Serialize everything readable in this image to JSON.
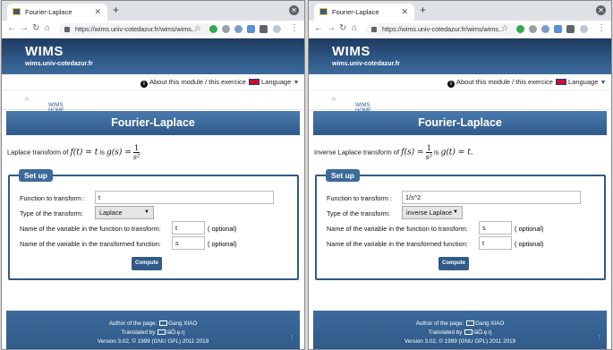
{
  "panes": [
    {
      "tab_title": "Fourier-Laplace",
      "url": "https://wims.univ-cotedazur.fr/wims/wims...",
      "site_title": "WIMS",
      "site_sub": "wims.univ-cotedazur.fr",
      "about_label": "About this module / this exercice",
      "language_label": "Language",
      "breadcrumb": "WIMS HOME",
      "page_title": "Fourier-Laplace",
      "formula": {
        "intro": "Laplace transform of",
        "lhs_var": "f(t) = t",
        "is": "is",
        "rhs_var": "g(s) =",
        "num": "1",
        "den": "s²",
        "tail": "."
      },
      "setup": {
        "legend": "Set up",
        "function_label": "Function to transform :",
        "function_value": "t",
        "type_label": "Type of the transform:",
        "type_value": "Laplace",
        "var_label": "Name of the variable in the function to transform:",
        "var_value": "t",
        "var_optional": "( optional)",
        "tvar_label": "Name of the variable in the transformed function:",
        "tvar_value": "s",
        "tvar_optional": "( optional)",
        "compute_label": "Compute"
      },
      "footer": {
        "author": "Author of the page:",
        "author_name": "Gang XIAO",
        "translated": "Translated by",
        "translator": "lãÖ.ę.ŋ",
        "version": "Version 3.02, © 1999 (GNU GPL) 2011 2019"
      }
    },
    {
      "tab_title": "Fourier-Laplace",
      "url": "https://wims.univ-cotedazur.fr/wims/wims...",
      "site_title": "WIMS",
      "site_sub": "wims.univ-cotedazur.fr",
      "about_label": "About this module / this exercice",
      "language_label": "Language",
      "breadcrumb": "WIMS HOME",
      "page_title": "Fourier-Laplace",
      "formula": {
        "intro": "Inverse Laplace transform of",
        "lhs_var": "f(s) =",
        "num": "1",
        "den": "s²",
        "is": "is",
        "rhs_var": "g(t) = t.",
        "tail": ""
      },
      "setup": {
        "legend": "Set up",
        "function_label": "Function to transform :",
        "function_value": "1/s^2",
        "type_label": "Type of the transform:",
        "type_value": "inverse Laplace",
        "var_label": "Name of the variable in the function to transform:",
        "var_value": "s",
        "var_optional": "( optional)",
        "tvar_label": "Name of the variable in the transformed function:",
        "tvar_value": "t",
        "tvar_optional": "( optional)",
        "compute_label": "Compute"
      },
      "footer": {
        "author": "Author of the page:",
        "author_name": "Gang XIAO",
        "translated": "Translated by",
        "translator": "lãÖ.ę.ŋ",
        "version": "Version 3.02, © 1999 (GNU GPL) 2011 2019"
      }
    }
  ],
  "colors": {
    "accent": "#2f5a8a",
    "banner_dark": "#1e3a5f"
  },
  "icons": [
    "wims-favicon-icon",
    "back-icon",
    "forward-icon",
    "reload-icon",
    "home-icon",
    "lock-icon",
    "star-icon",
    "info-icon",
    "uk-flag-icon",
    "envelope-icon",
    "up-arrow-icon"
  ]
}
